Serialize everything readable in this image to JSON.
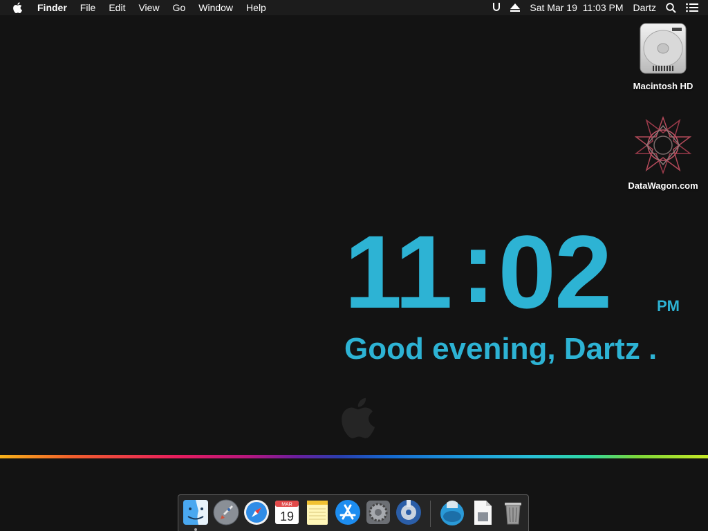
{
  "menubar": {
    "items": [
      "Finder",
      "File",
      "Edit",
      "View",
      "Go",
      "Window",
      "Help"
    ],
    "date_time": "Sat Mar 19  11:03 PM",
    "user": "Dartz"
  },
  "desktop": {
    "icons": [
      {
        "label": "Macintosh HD",
        "icon": "hard-drive-icon"
      },
      {
        "label": "DataWagon.com",
        "icon": "geometric-star-icon"
      }
    ]
  },
  "clock": {
    "hours": "11",
    "minutes": "02",
    "ampm": "PM",
    "greeting": "Good evening, Dartz .",
    "color": "#2db3d4"
  },
  "dock": {
    "apps": [
      {
        "name": "Finder",
        "icon": "finder-icon"
      },
      {
        "name": "Launchpad",
        "icon": "rocket-icon"
      },
      {
        "name": "Safari",
        "icon": "compass-icon"
      },
      {
        "name": "Calendar",
        "icon": "calendar-icon",
        "month": "MAR",
        "day": "19"
      },
      {
        "name": "Notes",
        "icon": "notes-icon"
      },
      {
        "name": "App Store",
        "icon": "app-store-icon"
      },
      {
        "name": "System Preferences",
        "icon": "gear-icon"
      },
      {
        "name": "Utility",
        "icon": "utility-disc-icon"
      },
      {
        "name": "Downloads",
        "icon": "downloads-icon"
      },
      {
        "name": "Document",
        "icon": "document-icon"
      },
      {
        "name": "Trash",
        "icon": "trash-icon"
      }
    ]
  }
}
